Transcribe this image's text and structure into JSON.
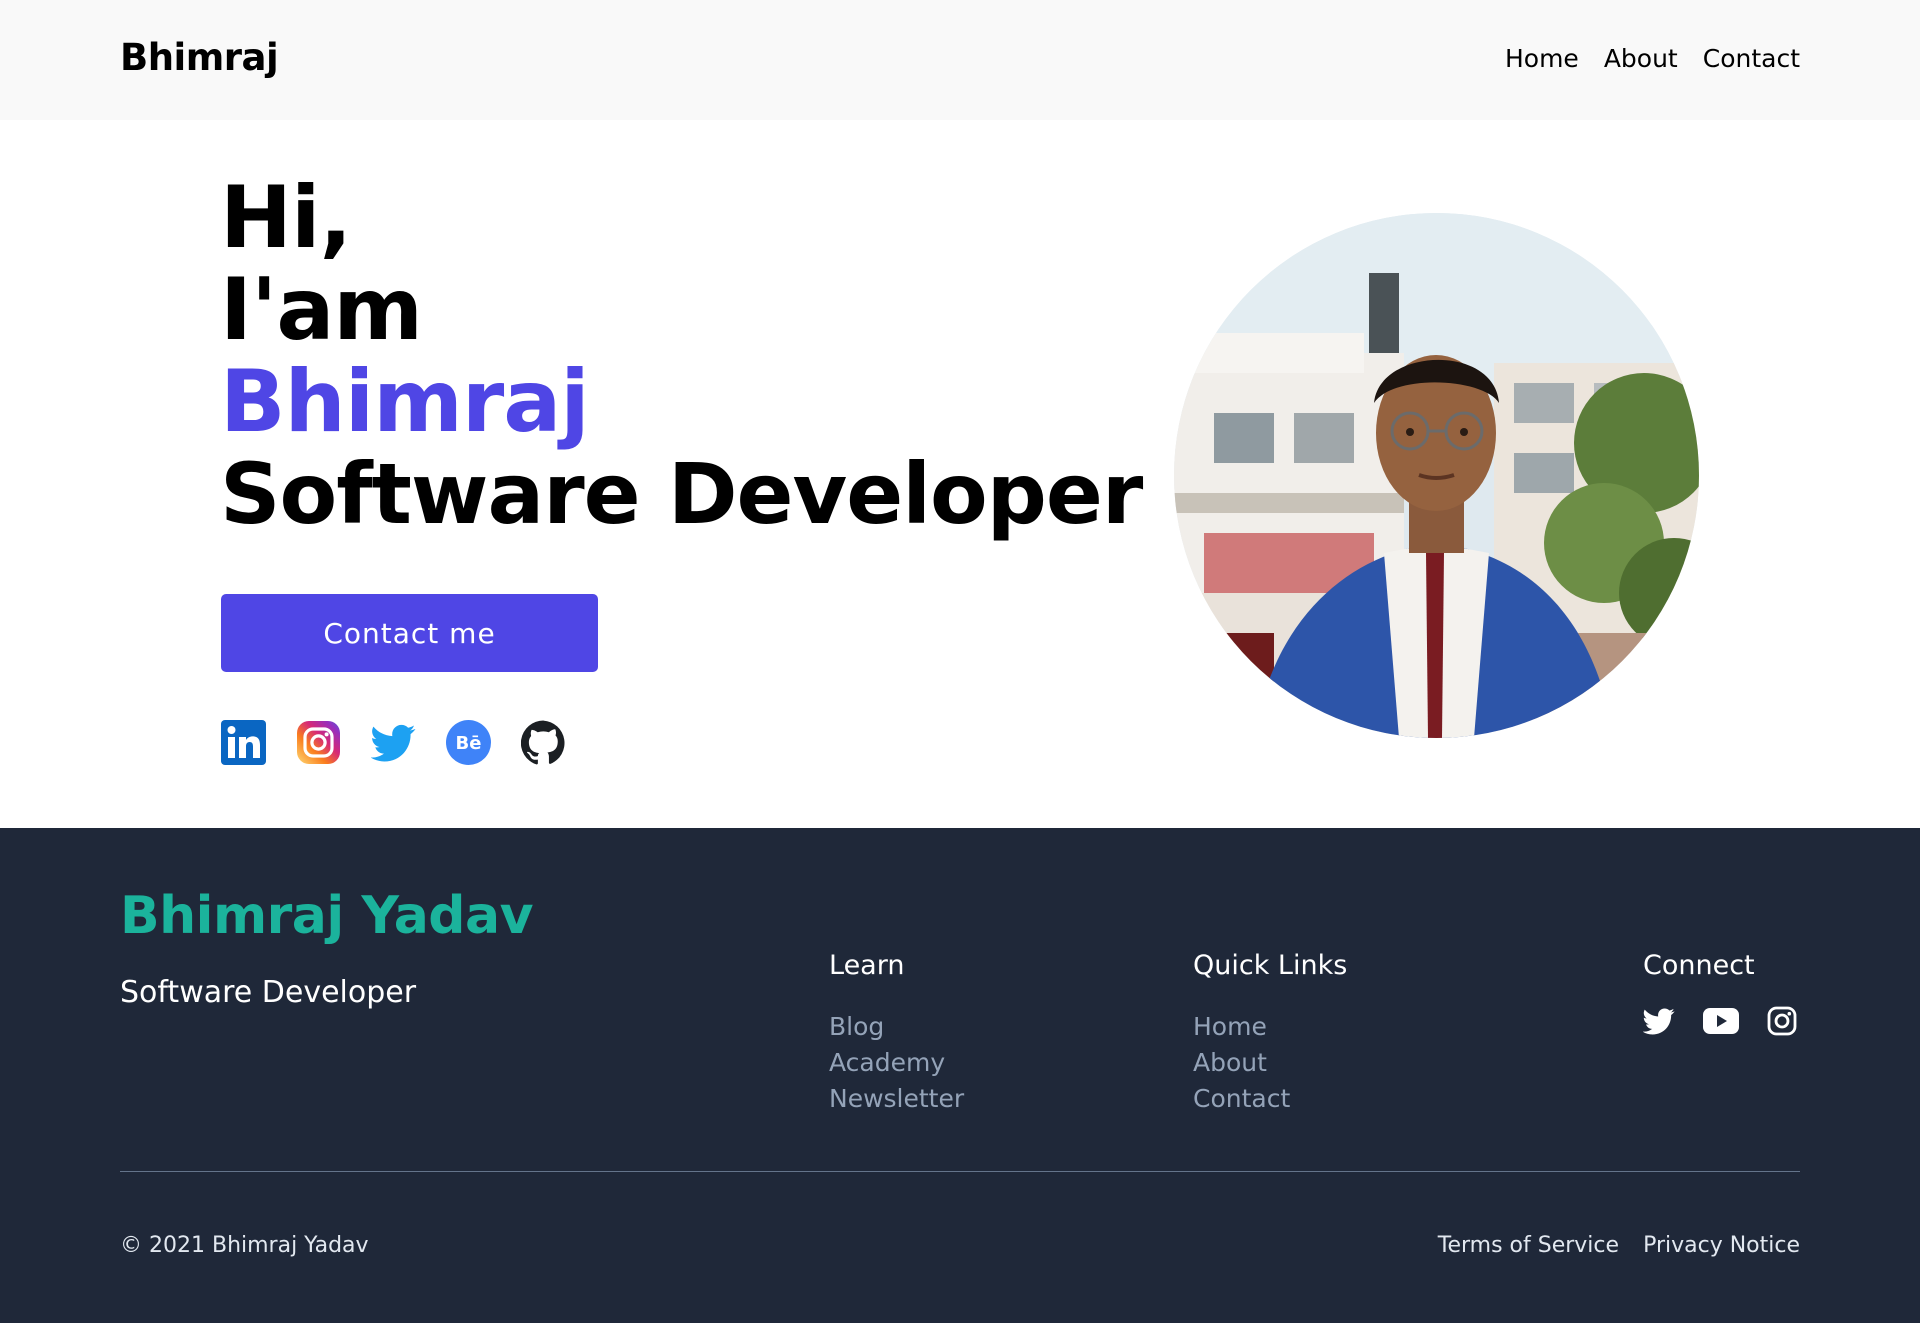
{
  "header": {
    "brand": "Bhimraj",
    "nav": [
      "Home",
      "About",
      "Contact"
    ]
  },
  "hero": {
    "line1": "Hi,",
    "line2": "I'am",
    "name": "Bhimraj",
    "role": "Software Developer",
    "cta": "Contact me",
    "accent": "#4f46e5",
    "socials": [
      "linkedin-icon",
      "instagram-icon",
      "twitter-icon",
      "behance-icon",
      "github-icon"
    ],
    "behance_text": "Bē"
  },
  "footer": {
    "name": "Bhimraj Yadav",
    "role": "Software Developer",
    "name_color": "#1bb39c",
    "background": "#1f2839",
    "learn": {
      "title": "Learn",
      "links": [
        "Blog",
        "Academy",
        "Newsletter"
      ]
    },
    "quick_links": {
      "title": "Quick Links",
      "links": [
        "Home",
        "About",
        "Contact"
      ]
    },
    "connect": {
      "title": "Connect",
      "icons": [
        "twitter-icon",
        "youtube-icon",
        "instagram-icon"
      ]
    },
    "copyright": "© 2021 Bhimraj Yadav",
    "legal": [
      "Terms of Service",
      "Privacy Notice"
    ]
  }
}
